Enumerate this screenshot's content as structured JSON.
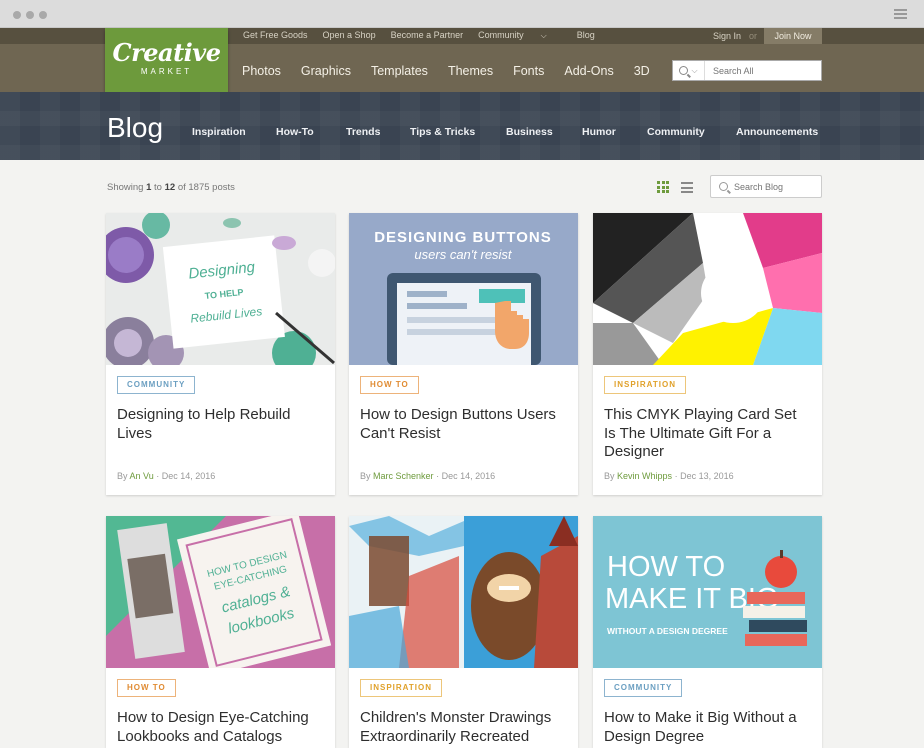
{
  "header": {
    "top_links": [
      "Get Free Goods",
      "Open a Shop",
      "Become a Partner",
      "Community",
      "Blog"
    ],
    "sign_in": "Sign In",
    "or": "or",
    "join": "Join Now",
    "nav": [
      "Photos",
      "Graphics",
      "Templates",
      "Themes",
      "Fonts",
      "Add-Ons",
      "3D"
    ],
    "search_placeholder": "Search All"
  },
  "logo": {
    "line1": "Creative",
    "line2": "MARKET"
  },
  "blog": {
    "title": "Blog",
    "nav": [
      "Inspiration",
      "How-To",
      "Trends",
      "Tips & Tricks",
      "Business",
      "Humor",
      "Community",
      "Announcements"
    ],
    "showing_prefix": "Showing",
    "showing_from": "1",
    "showing_to_word": "to",
    "showing_to": "12",
    "showing_suffix": "of 1875 posts",
    "search_placeholder": "Search Blog"
  },
  "cards": [
    {
      "tag": "COMMUNITY",
      "title": "Designing to Help Rebuild Lives",
      "by": "By",
      "author": "An Vu",
      "date": "· Dec 14, 2016",
      "image_text": [
        "Designing",
        "TO HELP",
        "Rebuild Lives"
      ]
    },
    {
      "tag": "HOW TO",
      "title": "How to Design Buttons Users Can't Resist",
      "by": "By",
      "author": "Marc Schenker",
      "date": "· Dec 14, 2016",
      "image_text": [
        "DESIGNING BUTTONS",
        "users can't resist"
      ]
    },
    {
      "tag": "INSPIRATION",
      "title": "This CMYK Playing Card Set Is The Ultimate Gift For a Designer",
      "by": "By",
      "author": "Kevin Whipps",
      "date": "· Dec 13, 2016",
      "image_text": []
    },
    {
      "tag": "HOW TO",
      "title": "How to Design Eye-Catching Lookbooks and Catalogs",
      "image_text": [
        "HOW TO DESIGN",
        "EYE-CATCHING",
        "catalogs &",
        "lookbooks"
      ]
    },
    {
      "tag": "INSPIRATION",
      "title": "Children's Monster Drawings Extraordinarily Recreated",
      "image_text": []
    },
    {
      "tag": "COMMUNITY",
      "title": "How to Make it Big Without a Design Degree",
      "image_text": [
        "HOW TO",
        "MAKE IT BIG",
        "WITHOUT A DESIGN DEGREE"
      ]
    }
  ]
}
